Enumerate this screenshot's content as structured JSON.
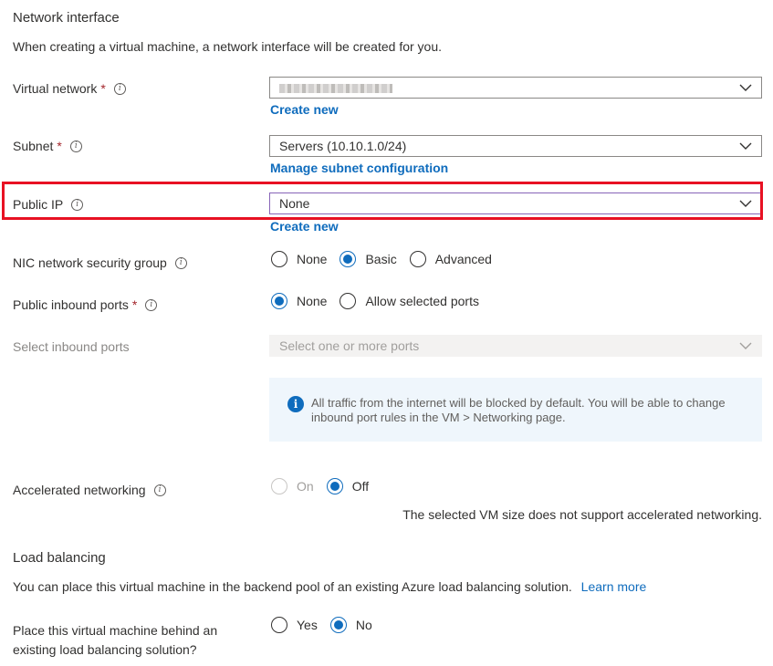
{
  "network_interface": {
    "title": "Network interface",
    "description": "When creating a virtual machine, a network interface will be created for you."
  },
  "virtual_network": {
    "label": "Virtual network",
    "required_mark": "*",
    "create_new_link": "Create new"
  },
  "subnet": {
    "label": "Subnet",
    "required_mark": "*",
    "value": "Servers (10.10.1.0/24)",
    "manage_link": "Manage subnet configuration"
  },
  "public_ip": {
    "label": "Public IP",
    "value": "None",
    "create_new_link": "Create new"
  },
  "nic_nsg": {
    "label": "NIC network security group",
    "options": [
      "None",
      "Basic",
      "Advanced"
    ],
    "selected": "Basic"
  },
  "public_inbound_ports": {
    "label": "Public inbound ports",
    "required_mark": "*",
    "options": [
      "None",
      "Allow selected ports"
    ],
    "selected": "None"
  },
  "select_inbound_ports": {
    "label": "Select inbound ports",
    "placeholder": "Select one or more ports"
  },
  "info_message": {
    "text": "All traffic from the internet will be blocked by default. You will be able to change inbound port rules in the VM > Networking page."
  },
  "accelerated_networking": {
    "label": "Accelerated networking",
    "options": [
      "On",
      "Off"
    ],
    "selected": "Off",
    "note": "The selected VM size does not support accelerated networking."
  },
  "load_balancing": {
    "title": "Load balancing",
    "description": "You can place this virtual machine in the backend pool of an existing Azure load balancing solution.",
    "learn_more_link": "Learn more",
    "question_line1": "Place this virtual machine behind an",
    "question_line2": "existing load balancing solution?",
    "options": [
      "Yes",
      "No"
    ],
    "selected": "No"
  },
  "icons": {
    "info": "info-icon",
    "chevron": "chevron-down-icon",
    "info_filled": "info-filled-icon"
  },
  "colors": {
    "accent": "#0f6cbd",
    "highlight_border": "#e81123",
    "required": "#a4262c",
    "info_background": "#eff6fc"
  }
}
